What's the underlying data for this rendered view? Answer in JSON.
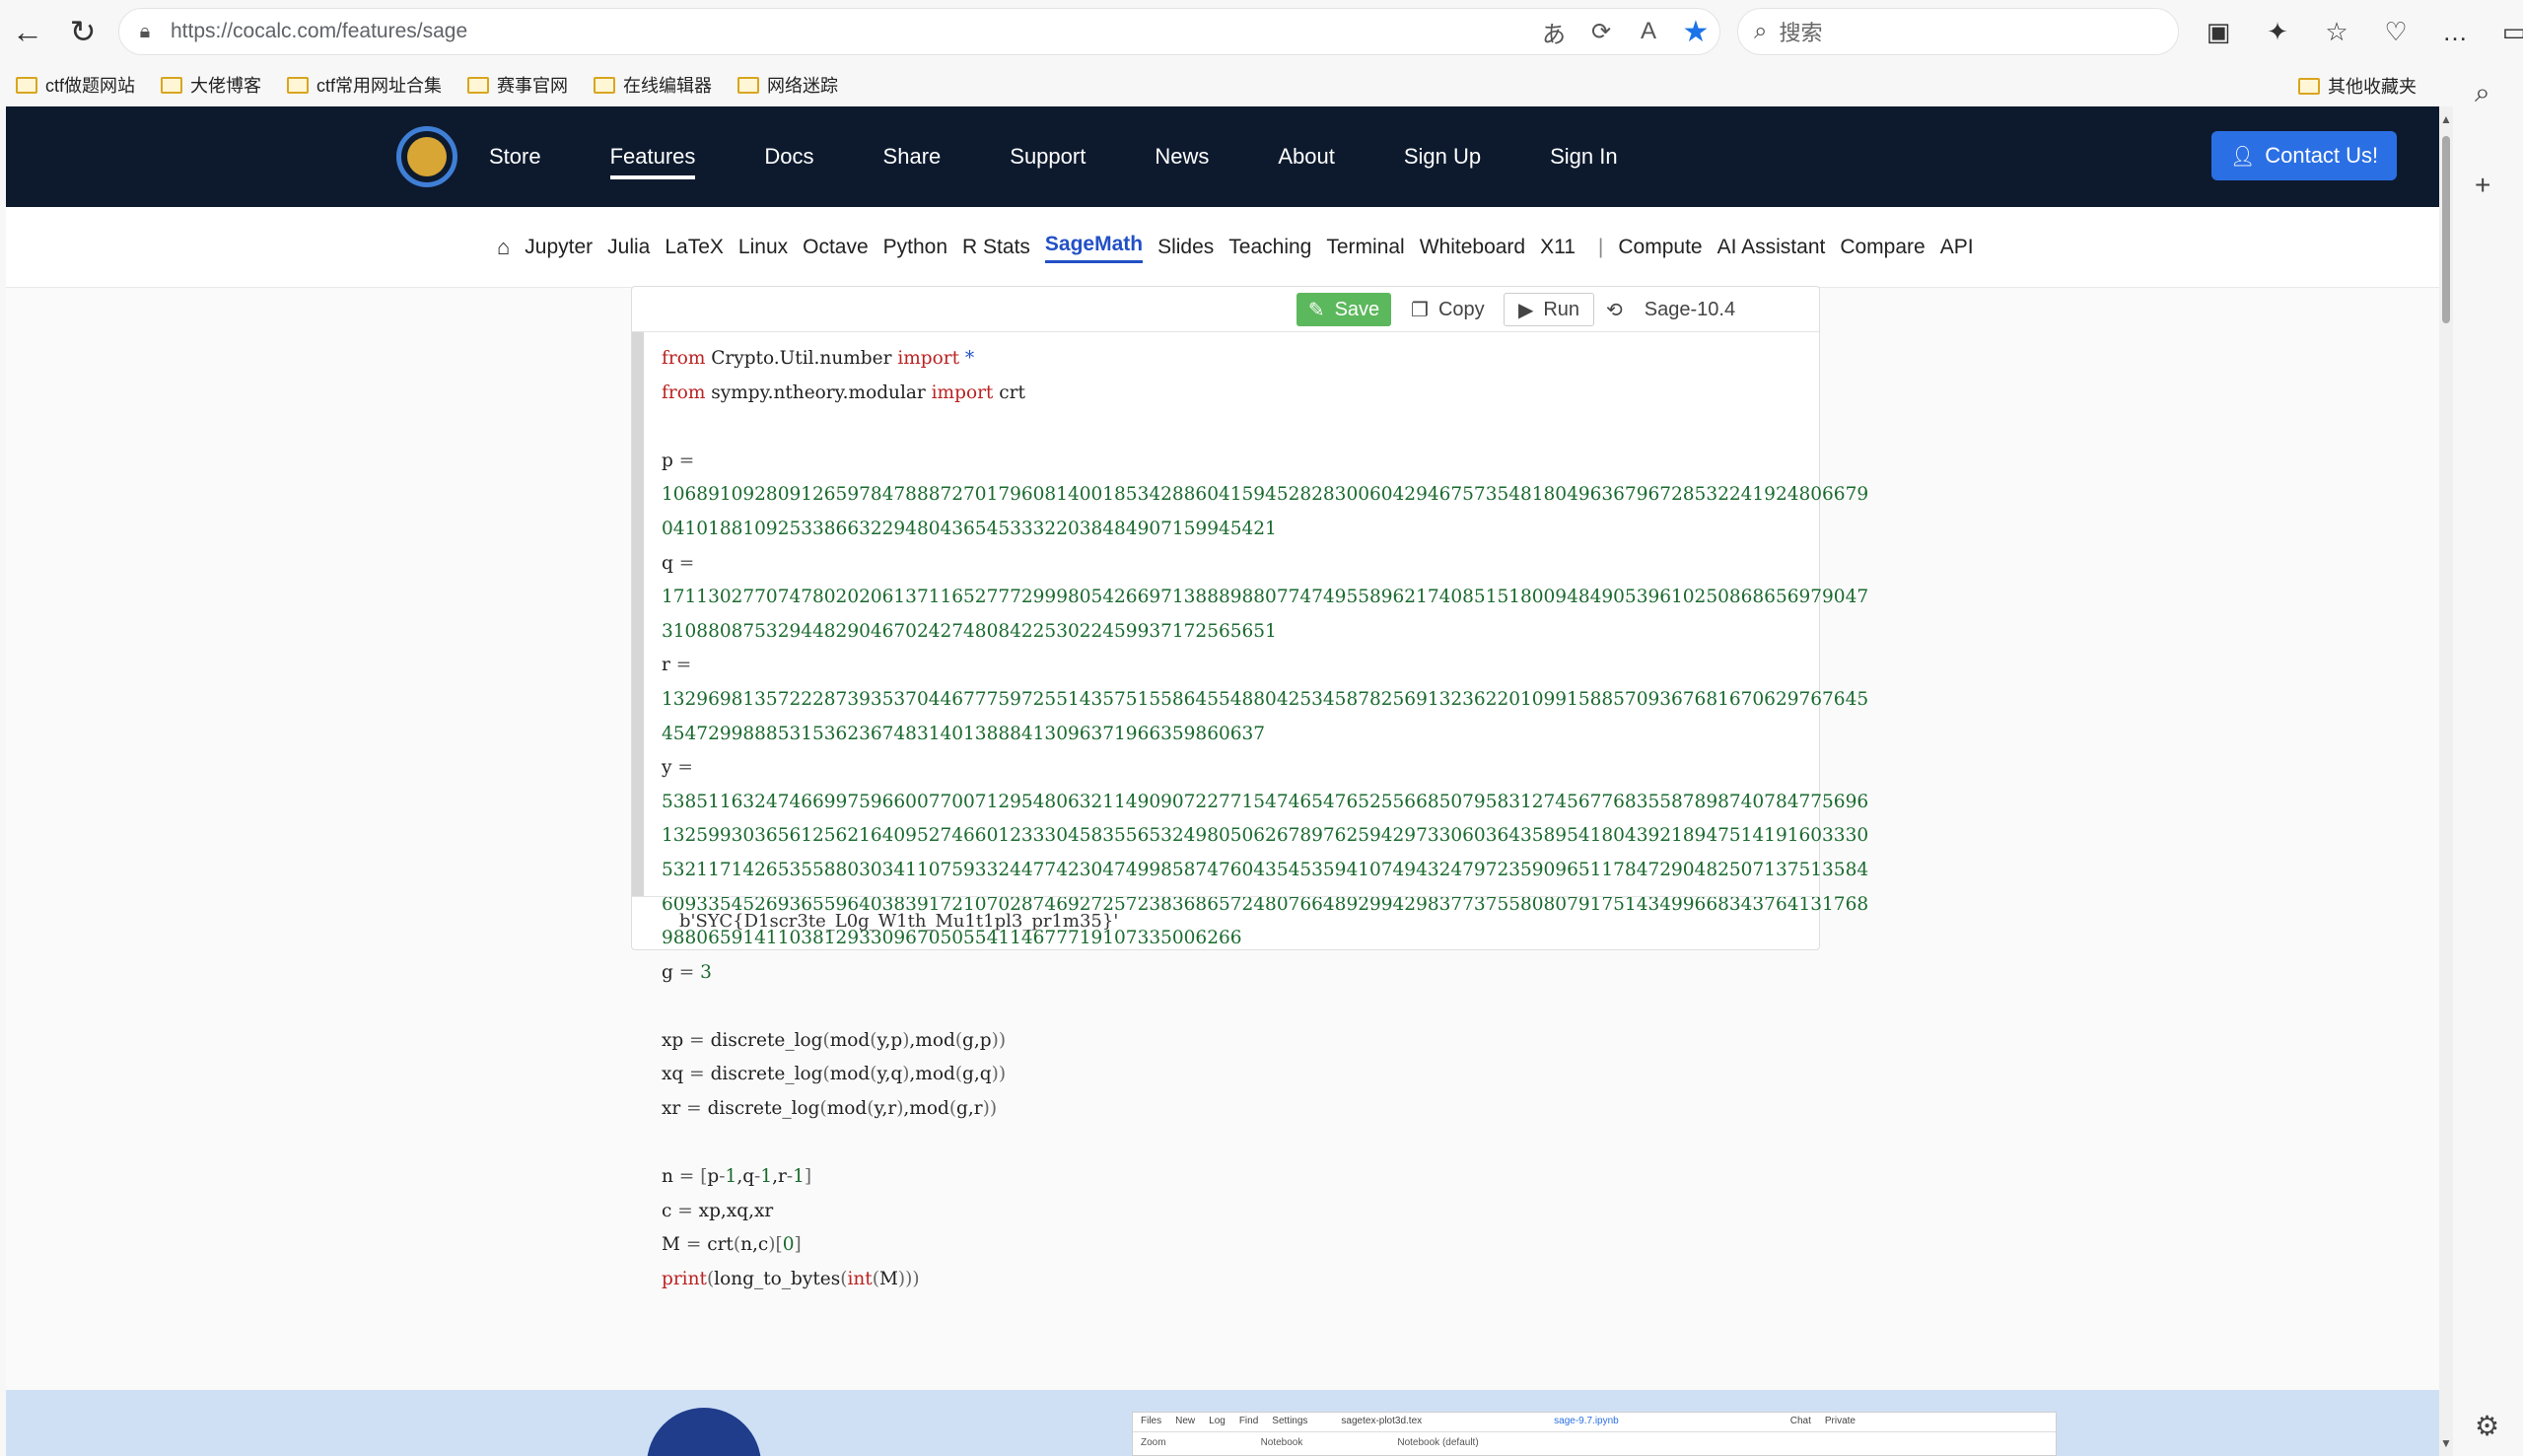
{
  "browser": {
    "url": "https://cocalc.com/features/sage",
    "search_placeholder": "搜索",
    "bookmarks": [
      "ctf做题网站",
      "大佬博客",
      "ctf常用网址合集",
      "赛事官网",
      "在线编辑器",
      "网络迷踪"
    ],
    "other_bookmarks": "其他收藏夹"
  },
  "topnav": {
    "links": [
      "Store",
      "Features",
      "Docs",
      "Share",
      "Support",
      "News",
      "About",
      "Sign Up",
      "Sign In"
    ],
    "active": "Features",
    "contact_label": "Contact Us!"
  },
  "subnav": {
    "items": [
      "Jupyter",
      "Julia",
      "LaTeX",
      "Linux",
      "Octave",
      "Python",
      "R Stats",
      "SageMath",
      "Slides",
      "Teaching",
      "Terminal",
      "Whiteboard",
      "X11"
    ],
    "items_after_sep": [
      "Compute",
      "AI Assistant",
      "Compare",
      "API"
    ],
    "selected": "SageMath"
  },
  "editor": {
    "save_label": "Save",
    "copy_label": "Copy",
    "run_label": "Run",
    "kernel": "Sage-10.4",
    "output": "b'SYC{D1scr3te_L0g_W1th_Mu1t1pl3_pr1m35}'"
  },
  "mini_screenshot": {
    "row1": [
      "Files",
      "New",
      "Log",
      "Find",
      "Settings",
      "sagetex-plot3d.tex",
      "sage-9.7.ipynb",
      "Chat",
      "Private"
    ],
    "row2": [
      "Zoom",
      "Notebook",
      "Notebook (default)"
    ]
  }
}
